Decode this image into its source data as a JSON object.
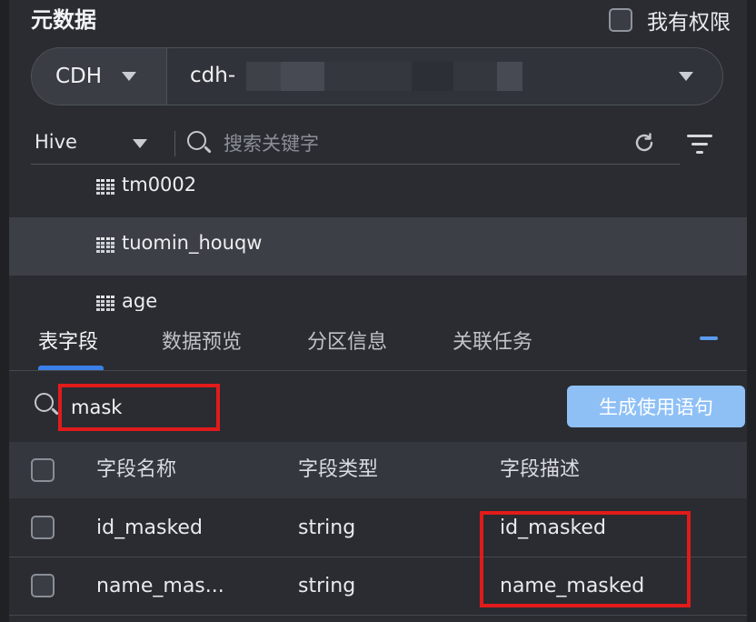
{
  "header": {
    "title": "元数据",
    "permission_label": "我有权限",
    "permission_checked": false
  },
  "source": {
    "type": "CDH",
    "cluster_name": "cdh-"
  },
  "filter": {
    "db_type": "Hive",
    "search_placeholder": "搜索关键字",
    "search_value": ""
  },
  "tree": {
    "items": [
      {
        "label": "tm0002",
        "selected": false
      },
      {
        "label": "tuomin_houqw",
        "selected": true
      },
      {
        "label": "age",
        "selected": false
      }
    ]
  },
  "tabs": [
    {
      "label": "表字段",
      "active": true
    },
    {
      "label": "数据预览",
      "active": false
    },
    {
      "label": "分区信息",
      "active": false
    },
    {
      "label": "关联任务",
      "active": false
    }
  ],
  "field_search": {
    "value": "mask",
    "generate_button": "生成使用语句"
  },
  "table": {
    "columns": [
      "字段名称",
      "字段类型",
      "字段描述"
    ],
    "rows": [
      {
        "name": "id_masked",
        "type": "string",
        "description": "id_masked"
      },
      {
        "name": "name_mas...",
        "type": "string",
        "description": "name_masked"
      }
    ]
  },
  "colors": {
    "background": "#2a2c31",
    "accent": "#3b7fe8",
    "button": "#8ec0f6",
    "highlight": "#e11b1b"
  }
}
